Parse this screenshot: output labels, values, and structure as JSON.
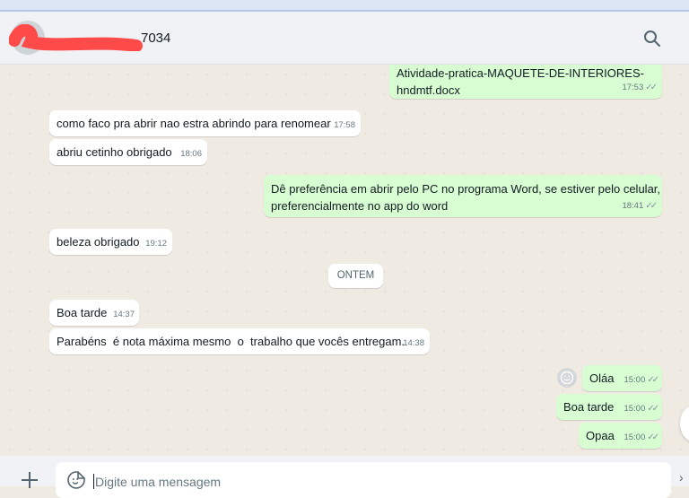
{
  "header": {
    "contact_name_suffix": "7034"
  },
  "messages": [
    {
      "dir": "out",
      "lines": [
        "Atividade-pratica-MAQUETE-DE-INTERIORES-",
        "hndmtf.docx"
      ],
      "time": "17:53"
    },
    {
      "dir": "in",
      "lines": [
        "como faco pra abrir nao estra abrindo para renomear"
      ],
      "time": "17:58"
    },
    {
      "dir": "in",
      "lines": [
        "abriu cetinho obrigado"
      ],
      "time": "18:06"
    },
    {
      "dir": "out",
      "lines": [
        "Dê preferência em abrir pelo PC no programa Word, se estiver pelo celular,",
        "preferencialmente no app do word"
      ],
      "time": "18:41"
    },
    {
      "dir": "in",
      "lines": [
        "beleza obrigado"
      ],
      "time": "19:12"
    },
    {
      "dir": "in",
      "lines": [
        "Boa tarde"
      ],
      "time": "14:37"
    },
    {
      "dir": "in",
      "lines": [
        "Parabéns  é nota máxima mesmo  o  trabalho que vocês entregam."
      ],
      "time": "14:38"
    },
    {
      "dir": "out",
      "lines": [
        "Oláa"
      ],
      "time": "15:00"
    },
    {
      "dir": "out",
      "lines": [
        "Boa tarde"
      ],
      "time": "15:00"
    },
    {
      "dir": "out",
      "lines": [
        "Opaa"
      ],
      "time": "15:00"
    }
  ],
  "day_separator": "ONTEM",
  "composer": {
    "placeholder": "Digite uma mensagem"
  },
  "colors": {
    "incoming_bubble": "#ffffff",
    "outgoing_bubble": "#d9fdd3",
    "chat_background": "#efeae2",
    "redaction": "#ff4a4a"
  },
  "icons": {
    "search": "search-icon",
    "plus": "plus-icon",
    "sticker": "sticker-icon",
    "delivered": "double-check-icon"
  }
}
